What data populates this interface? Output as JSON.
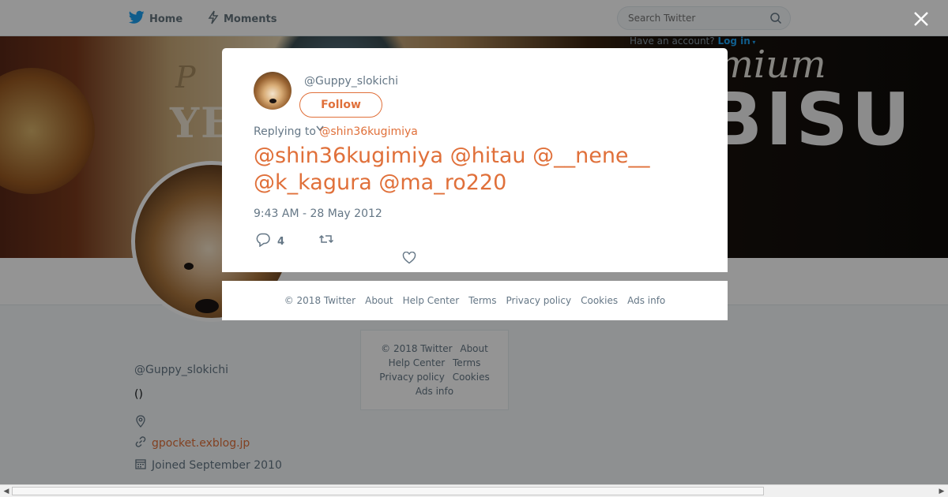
{
  "nav": {
    "home_label": "Home",
    "moments_label": "Moments",
    "search_placeholder": "Search Twitter",
    "have_account": "Have an account?",
    "login_label": "Log in"
  },
  "banner": {
    "text_left": "YE",
    "text_p": "P",
    "text_premium": "emium",
    "text_bisu": "BISU"
  },
  "profile": {
    "name": "",
    "handle": "@Guppy_slokichi",
    "bio": "()",
    "url": "gpocket.exblog.jp",
    "joined": "Joined September 2010"
  },
  "side_footer": {
    "copyright": "© 2018 Twitter",
    "about": "About",
    "help": "Help Center",
    "terms": "Terms",
    "privacy": "Privacy policy",
    "cookies": "Cookies",
    "ads": "Ads info"
  },
  "tweet": {
    "handle": "@Guppy_slokichi",
    "follow_label": "Follow",
    "replying_prefix": "Replying to",
    "replying_to": "@shin36kugimiya",
    "mention_1": "@shin36kugimiya",
    "mention_2": "@hitau",
    "mention_3": "@__nene__",
    "mention_4": "@k_kagura",
    "mention_5": "@ma_ro220",
    "body_rest": "",
    "timestamp": "9:43 AM - 28 May 2012",
    "reply_count": "4"
  },
  "modal_footer": {
    "copyright": "© 2018 Twitter",
    "about": "About",
    "help": "Help Center",
    "terms": "Terms",
    "privacy": "Privacy policy",
    "cookies": "Cookies",
    "ads": "Ads info"
  },
  "colors": {
    "accent": "#e0703a",
    "twitter_blue": "#1da1f2",
    "overlay": "rgba(0,0,0,0.42)"
  }
}
